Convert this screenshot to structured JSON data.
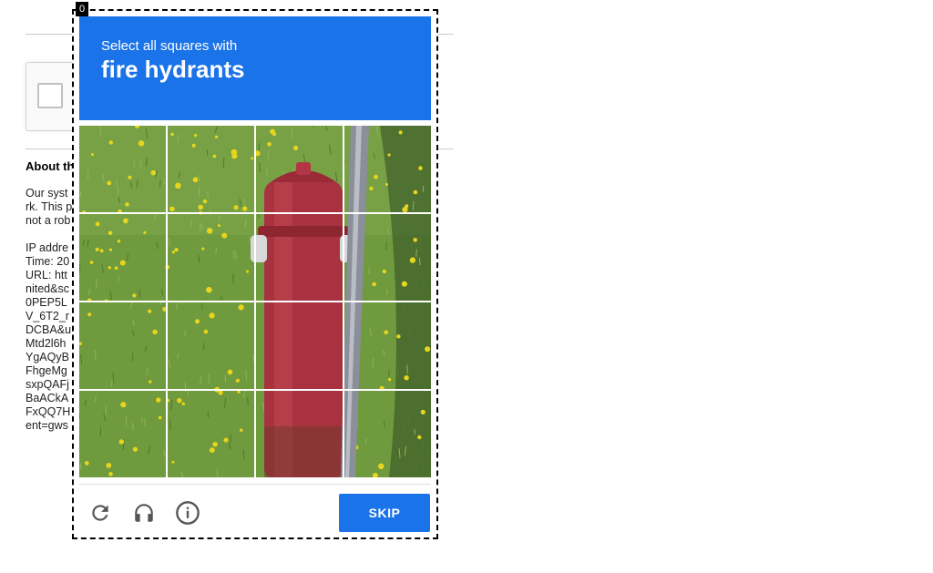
{
  "background": {
    "about_heading": "About th",
    "lines_1": [
      "Our syst",
      "rk. This p",
      "not a rob"
    ],
    "lines_2": [
      "IP addre",
      "Time: 20",
      "URL: htt",
      "nited&sc",
      "0PEP5L",
      "V_6T2_r",
      "DCBA&u",
      "Mtd2l6h",
      "YgAQyB",
      "FhgeMg",
      "sxpQAFj",
      "BaACkA",
      "FxQQ7H",
      "ent=gws"
    ]
  },
  "challenge": {
    "counter": "0",
    "instruction": "Select all squares with",
    "target": "fire hydrants",
    "skip_label": "SKIP",
    "icons": [
      "reload-icon",
      "audio-headphones-icon",
      "info-icon"
    ],
    "accent_color": "#1a73e8",
    "grid_rows": 4,
    "grid_cols": 4
  }
}
